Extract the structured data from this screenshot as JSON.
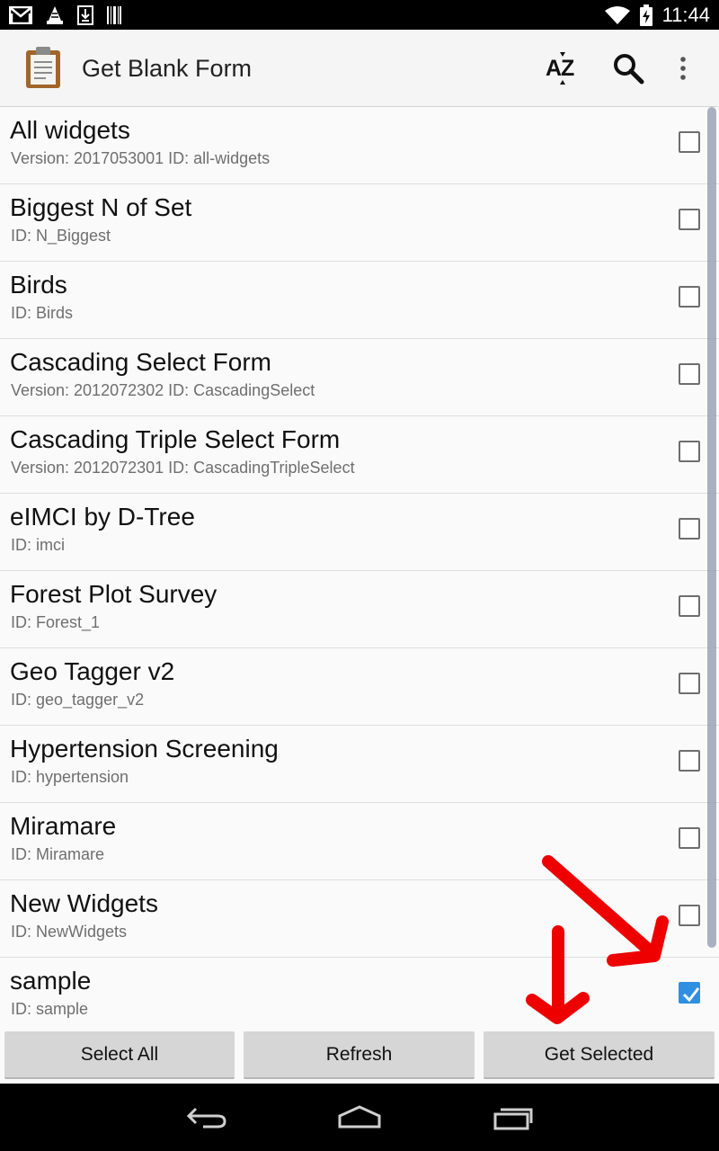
{
  "status_bar": {
    "time": "11:44",
    "left_icons": [
      "gmail-icon",
      "vlc-icon",
      "download-icon",
      "barcode-icon"
    ],
    "right_icons": [
      "wifi-icon",
      "battery-charging-icon"
    ]
  },
  "app_bar": {
    "title": "Get Blank Form",
    "actions": [
      "sort-az-icon",
      "search-icon",
      "overflow-menu-icon"
    ]
  },
  "forms": [
    {
      "title": "All widgets",
      "subtitle": "Version: 2017053001 ID: all-widgets",
      "checked": false
    },
    {
      "title": "Biggest N of Set",
      "subtitle": "ID: N_Biggest",
      "checked": false
    },
    {
      "title": "Birds",
      "subtitle": "ID: Birds",
      "checked": false
    },
    {
      "title": "Cascading Select Form",
      "subtitle": "Version: 2012072302 ID: CascadingSelect",
      "checked": false
    },
    {
      "title": "Cascading Triple Select Form",
      "subtitle": "Version: 2012072301 ID: CascadingTripleSelect",
      "checked": false
    },
    {
      "title": "eIMCI by D-Tree",
      "subtitle": "ID: imci",
      "checked": false
    },
    {
      "title": "Forest Plot Survey",
      "subtitle": "ID: Forest_1",
      "checked": false
    },
    {
      "title": "Geo Tagger v2",
      "subtitle": "ID: geo_tagger_v2",
      "checked": false
    },
    {
      "title": "Hypertension Screening",
      "subtitle": "ID: hypertension",
      "checked": false
    },
    {
      "title": "Miramare",
      "subtitle": "ID: Miramare",
      "checked": false
    },
    {
      "title": "New Widgets",
      "subtitle": "ID: NewWidgets",
      "checked": false
    },
    {
      "title": "sample",
      "subtitle": "ID: sample",
      "checked": true
    }
  ],
  "buttons": {
    "select_all": "Select All",
    "refresh": "Refresh",
    "get_selected": "Get Selected"
  },
  "nav_bar": [
    "back-icon",
    "home-icon",
    "recents-icon"
  ],
  "colors": {
    "checkbox_checked": "#2f8fe0",
    "annotation_arrow": "#ee0000",
    "app_bar_bg": "#f5f5f5",
    "button_bg": "#d6d6d6"
  }
}
